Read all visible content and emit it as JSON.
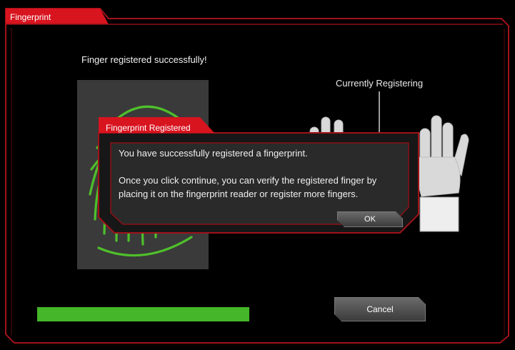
{
  "window": {
    "title": "Fingerprint"
  },
  "status": {
    "message": "Finger registered successfully!"
  },
  "hand": {
    "label": "Currently Registering"
  },
  "progress": {
    "fraction": 1.0
  },
  "buttons": {
    "cancel": "Cancel"
  },
  "dialog": {
    "title": "Fingerprint Registered",
    "message_line1": "You have successfully registered a fingerprint.",
    "message_line2": "Once you click continue, you can verify the registered finger by placing it on the fingerprint reader or register more fingers.",
    "ok": "OK"
  },
  "colors": {
    "accent": "#d8141f",
    "progress": "#45b62a",
    "fingerprint": "#4fc02b"
  }
}
